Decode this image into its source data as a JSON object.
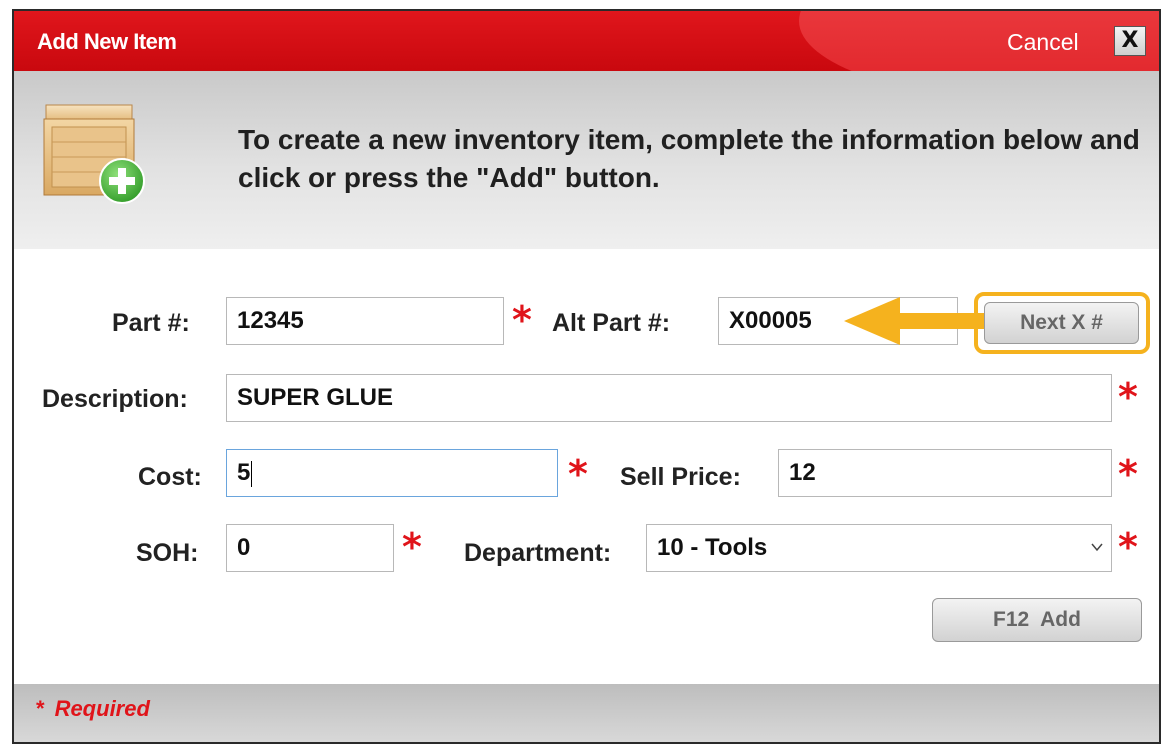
{
  "dialog": {
    "title": "Add New Item",
    "cancel_label": "Cancel",
    "close_label": "X"
  },
  "header": {
    "instruction": "To create a new inventory item, complete the information below and click or press the \"Add\" button."
  },
  "form": {
    "required_marker": "*",
    "part": {
      "label": "Part #:",
      "value": "12345"
    },
    "alt_part": {
      "label": "Alt Part #:",
      "value": "X00005"
    },
    "next_x_button": "Next X #",
    "description": {
      "label": "Description:",
      "value": "SUPER GLUE"
    },
    "cost": {
      "label": "Cost:",
      "value": "5"
    },
    "sell_price": {
      "label": "Sell Price:",
      "value": "12"
    },
    "soh": {
      "label": "SOH:",
      "value": "0"
    },
    "department": {
      "label": "Department:",
      "value": "10 - Tools"
    },
    "add_button": "F12  Add"
  },
  "footer": {
    "required_star": "*",
    "required_text": "Required"
  },
  "colors": {
    "title_bar": "#d40b11",
    "required": "#e0141a",
    "highlight": "#f5b21e"
  },
  "icons": {
    "header": "crate-add-icon",
    "callout": "arrow-left-icon",
    "department": "chevron-down-icon"
  }
}
